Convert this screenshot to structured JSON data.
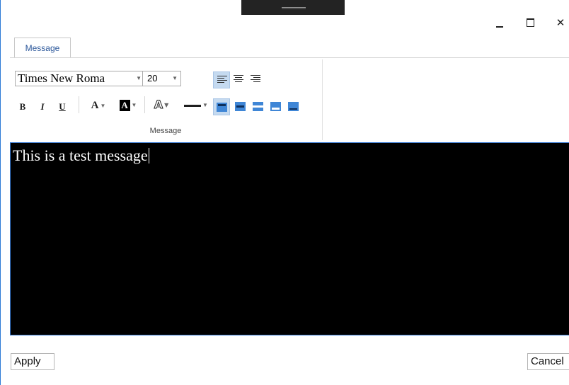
{
  "window": {
    "minimize_icon": "minimize-icon",
    "maximize_icon": "maximize-icon",
    "close_icon": "close-icon",
    "close_glyph": "✕"
  },
  "ribbon": {
    "tab_label": "Message",
    "group_label": "Message",
    "font_family": "Times New Roma",
    "font_size": "20",
    "bold_label": "B",
    "italic_label": "I",
    "underline_label": "U",
    "font_color_label": "A",
    "background_color_label": "A",
    "outline_label": "A"
  },
  "editor": {
    "text": "This is a test message",
    "background": "#000000",
    "text_color": "#ffffff"
  },
  "buttons": {
    "apply": "Apply",
    "cancel": "Cancel"
  },
  "colors": {
    "accent": "#2b7ad6",
    "selected": "#c5daf0",
    "position_icon": "#3f86d6"
  }
}
